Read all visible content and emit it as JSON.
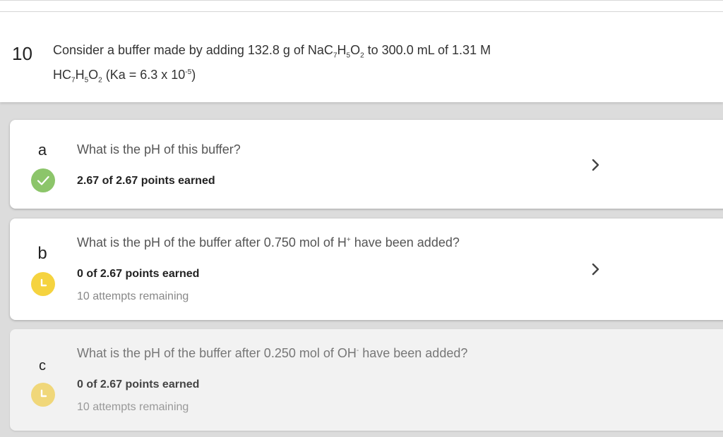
{
  "question": {
    "number": "10",
    "text_1": "Consider a buffer made by adding 132.8 g of NaC",
    "sub_7a": "7",
    "h_1": "H",
    "sub_5a": "5",
    "o_1": "O",
    "sub_2a": "2",
    "text_2": " to 300.0 mL of 1.31 M",
    "hc": "HC",
    "sub_7b": "7",
    "h_2": "H",
    "sub_5b": "5",
    "o_2": "O",
    "sub_2b": "2",
    "ka_text": " (Ka = 6.3 x 10",
    "ka_exp": "-5",
    "ka_close": ")"
  },
  "parts": [
    {
      "letter": "a",
      "prompt": "What is the pH of this buffer?",
      "points": "2.67 of 2.67 points earned",
      "status": "correct",
      "status_color": "#8cc56a"
    },
    {
      "letter": "b",
      "prompt_pre": "What is the pH of the buffer after 0.750 mol of H",
      "prompt_sup": "+",
      "prompt_post": " have been added?",
      "points": "0 of 2.67 points earned",
      "attempts": "10 attempts remaining",
      "status": "pending",
      "status_color": "#f5d33f"
    },
    {
      "letter": "c",
      "prompt_pre": "What is the pH of the buffer after 0.250 mol of OH",
      "prompt_sup": "-",
      "prompt_post": " have been added?",
      "points": "0 of 2.67 points earned",
      "attempts": "10 attempts remaining",
      "status": "pending",
      "status_color": "#f0d77a"
    }
  ],
  "icons": {
    "check": "check-icon",
    "clock": "clock-icon",
    "chevron": "chevron-right-icon"
  }
}
